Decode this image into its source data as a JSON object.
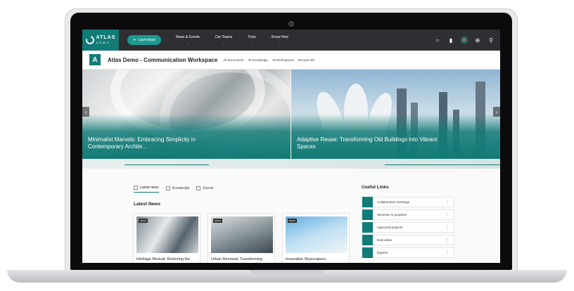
{
  "topbar": {
    "logo_text": "ATLAS",
    "logo_sub": "DEMO",
    "launchpad": "Launchpad",
    "nav": [
      "News & Events",
      "Our Teams",
      "Tools",
      "Know How"
    ]
  },
  "site": {
    "initial": "A",
    "title": "Atlas Demo - Communication Workspace",
    "links": [
      "All Documents",
      "All Knowledge",
      "All Workspaces",
      "Recycle Bin"
    ]
  },
  "hero": {
    "slides": [
      {
        "title": "Minimalist Marvels: Embracing Simplicity in Contemporary Archite..."
      },
      {
        "title": "Adaptive Reuse: Transforming Old Buildings into Vibrant Spaces"
      }
    ]
  },
  "tabs": [
    "Latest news",
    "Knowledge",
    "Events"
  ],
  "latest_heading": "Latest News",
  "news": [
    {
      "tag": "NEWS",
      "title": "Heritage Revival: Restoring the"
    },
    {
      "tag": "NEWS",
      "title": "Urban Renewal: Transforming"
    },
    {
      "tag": "NEWS",
      "title": "Innovative Skyscrapers:"
    }
  ],
  "useful_links": {
    "heading": "Useful Links",
    "items": [
      "Collaboration meetings",
      "Sketches in progress",
      "Approved projects",
      "New ideas",
      "Experts"
    ]
  },
  "colors": {
    "accent": "#127b77",
    "topbar": "#2d2f33"
  }
}
